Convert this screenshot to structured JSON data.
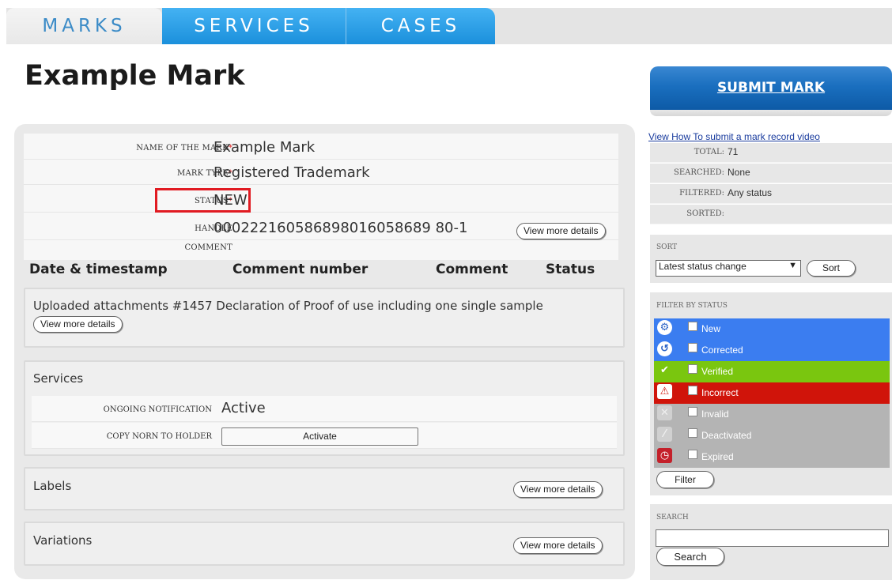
{
  "tabs": {
    "marks": "MARKS",
    "services": "SERVICES",
    "cases": "CASES"
  },
  "page_title": "Example Mark",
  "mark_details": {
    "name_label": "NAME OF THE MARK",
    "name_value": "Example Mark",
    "type_label": "MARK TYPE",
    "type_value": "Registered Trademark",
    "status_label": "STATUS",
    "status_value": "NEW",
    "handle_label": "HANDLE",
    "handle_value": "000222160586898016058689 80-1",
    "comment_label": "COMMENT",
    "required_marker": "*",
    "view_more_label": "View more details"
  },
  "comments_table": {
    "headers": [
      "Date & timestamp",
      "Comment number",
      "Comment",
      "Status"
    ]
  },
  "attachments": {
    "text": "Uploaded attachments #1457 Declaration of Proof of use including one single sample",
    "view_more_label": "View more details"
  },
  "services_section": {
    "title": "Services",
    "ongoing_label": "ONGOING NOTIFICATION",
    "ongoing_value": "Active",
    "copy_label": "COPY NORN TO HOLDER",
    "activate_label": "Activate"
  },
  "labels_section": {
    "title": "Labels",
    "view_more_label": "View more details"
  },
  "variations_section": {
    "title": "Variations",
    "view_more_label": "View more details"
  },
  "sidebar": {
    "submit_label": "SUBMIT MARK",
    "video_link": "View How To submit a mark record video",
    "stats": [
      {
        "label": "TOTAL:",
        "value": "71"
      },
      {
        "label": "SEARCHED:",
        "value": "None"
      },
      {
        "label": "FILTERED:",
        "value": "Any status"
      },
      {
        "label": "SORTED:",
        "value": ""
      }
    ],
    "sort_heading": "SORT",
    "sort_selected": "Latest status change",
    "sort_button": "Sort",
    "filter_heading": "FILTER BY STATUS",
    "filter_button": "Filter",
    "statuses": [
      {
        "label": "New",
        "color": "#3b7df0",
        "icon": "gear-icon"
      },
      {
        "label": "Corrected",
        "color": "#3b7df0",
        "icon": "undo-icon"
      },
      {
        "label": "Verified",
        "color": "#7ac60f",
        "icon": "check-icon"
      },
      {
        "label": "Incorrect",
        "color": "#d0140a",
        "icon": "warning-icon"
      },
      {
        "label": "Invalid",
        "color": "#b4b4b4",
        "icon": "cross-icon"
      },
      {
        "label": "Deactivated",
        "color": "#b4b4b4",
        "icon": "slash-icon"
      },
      {
        "label": "Expired",
        "color": "#b4b4b4",
        "icon": "clock-icon"
      }
    ],
    "search_heading": "SEARCH",
    "search_button": "Search"
  }
}
